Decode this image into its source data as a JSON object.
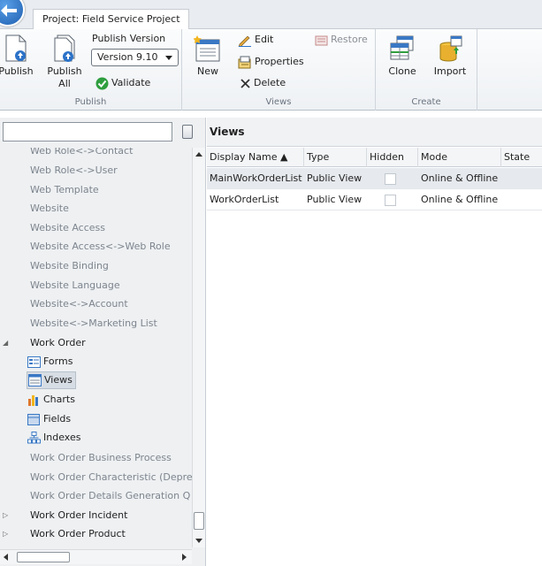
{
  "project_tab": "Project: Field Service Project",
  "ribbon": {
    "publish_group": {
      "label": "Publish",
      "publish": "Publish",
      "publish_all_line1": "Publish",
      "publish_all_line2": "All",
      "version_label": "Publish Version",
      "version_value": "Version 9.10",
      "validate": "Validate"
    },
    "views_group": {
      "label": "Views",
      "new": "New",
      "edit": "Edit",
      "properties": "Properties",
      "delete": "Delete",
      "restore": "Restore"
    },
    "create_group": {
      "label": "Create",
      "clone": "Clone",
      "import": "Import"
    }
  },
  "search": {
    "placeholder": ""
  },
  "tree": {
    "items": [
      "Web Role<->Contact",
      "Web Role<->User",
      "Web Template",
      "Website",
      "Website Access",
      "Website Access<->Web Role",
      "Website Binding",
      "Website Language",
      "Website<->Account",
      "Website<->Marketing List"
    ],
    "work_order": "Work Order",
    "children": {
      "forms": "Forms",
      "views": "Views",
      "charts": "Charts",
      "fields": "Fields",
      "indexes": "Indexes"
    },
    "after": [
      "Work Order Business Process",
      "Work Order Characteristic (Depre",
      "Work Order Details Generation Q"
    ],
    "incident": "Work Order Incident",
    "product": "Work Order Product"
  },
  "views_panel": {
    "title": "Views",
    "columns": [
      "Display Name ▲",
      "Type",
      "Hidden",
      "Mode",
      "State"
    ],
    "rows": [
      {
        "name": "MainWorkOrderList",
        "type": "Public View",
        "mode": "Online & Offline"
      },
      {
        "name": "WorkOrderList",
        "type": "Public View",
        "mode": "Online & Offline"
      }
    ]
  }
}
